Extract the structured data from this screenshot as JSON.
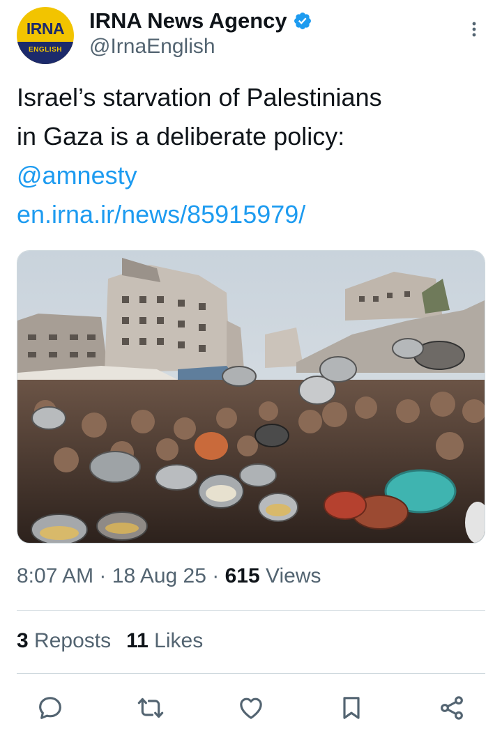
{
  "author": {
    "display_name": "IRNA News Agency",
    "handle": "@IrnaEnglish",
    "avatar_logo": "IRNA",
    "avatar_sub": "ENGLISH",
    "verified": true
  },
  "tweet": {
    "text_line1": "Israel’s starvation of Palestinians",
    "text_line2": "in Gaza is a deliberate policy:",
    "mention": "@amnesty",
    "link": "en.irna.ir/news/85915979/"
  },
  "meta": {
    "time": "8:07 AM",
    "date": "18 Aug 25",
    "views_count": "615",
    "views_label": "Views",
    "separator": "·"
  },
  "stats": {
    "reposts_count": "3",
    "reposts_label": "Reposts",
    "likes_count": "11",
    "likes_label": "Likes"
  },
  "icons": {
    "more": "more-vertical-icon",
    "reply": "reply-icon",
    "repost": "repost-icon",
    "like": "heart-icon",
    "bookmark": "bookmark-icon",
    "share": "share-icon"
  },
  "colors": {
    "link": "#1d9bf0",
    "verified": "#1d9bf0",
    "text": "#0f1419",
    "secondary": "#536471"
  }
}
